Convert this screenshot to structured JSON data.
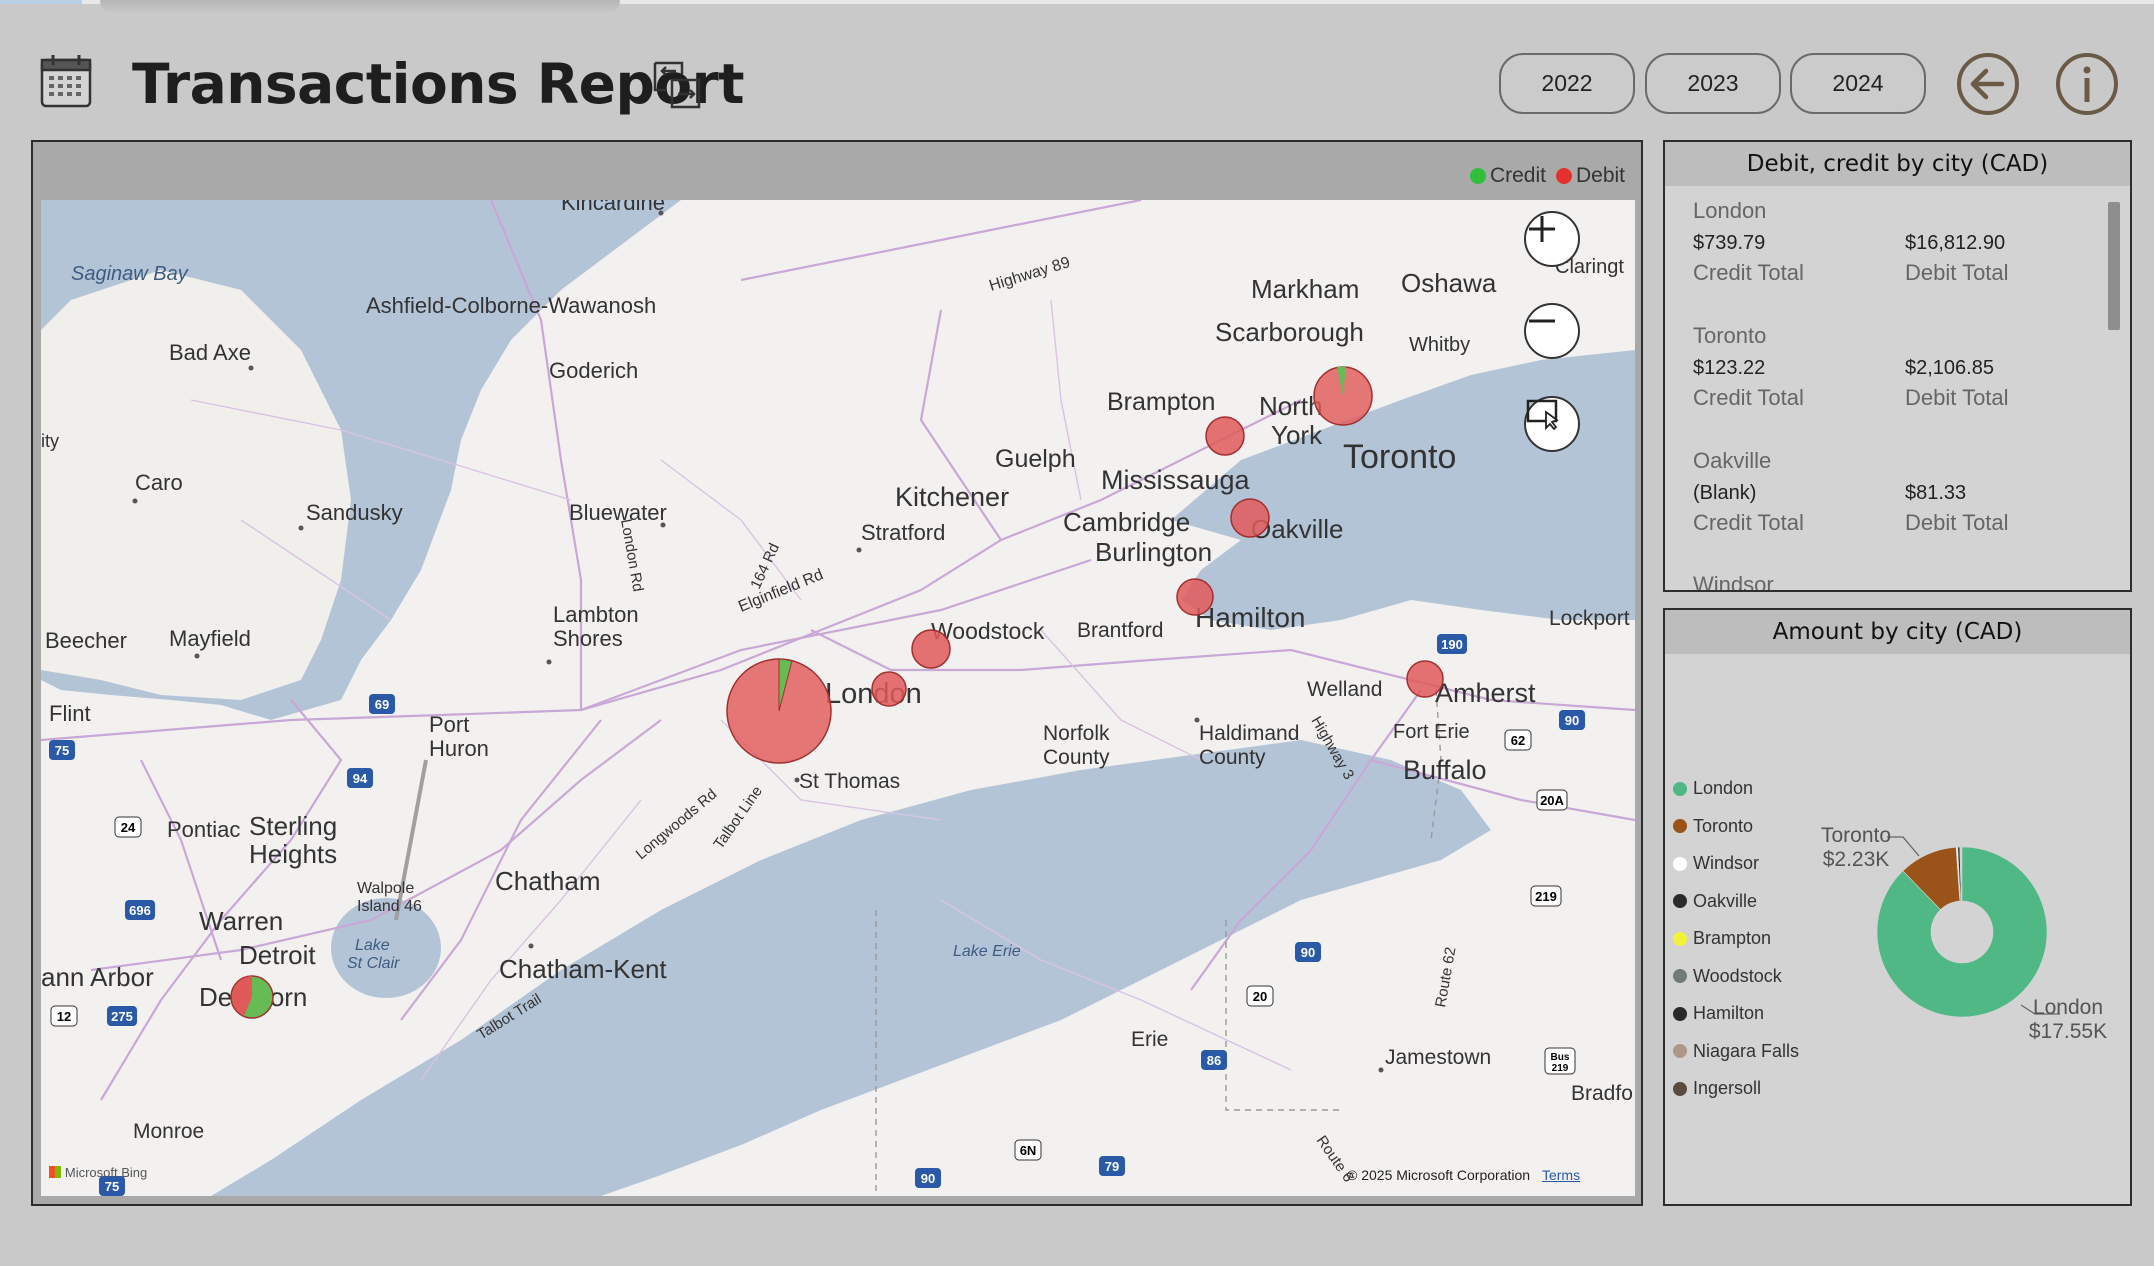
{
  "header": {
    "title": "Transactions Report",
    "years": [
      "2022",
      "2023",
      "2024"
    ]
  },
  "map_visual": {
    "legend": [
      {
        "label": "Credit",
        "color": "#2fbf3a"
      },
      {
        "label": "Debit",
        "color": "#e53030"
      }
    ],
    "places": [
      "Kincardine",
      "Saginaw Bay",
      "Ashfield-Colborne-Wawanosh",
      "Highway 89",
      "Claringt",
      "Markham",
      "Oshawa",
      "Whitby",
      "Bad Axe",
      "Goderich",
      "Scarborough",
      "Brampton",
      "North",
      "York",
      "Toronto",
      "Guelph",
      "Mississauga",
      "Kitchener",
      "Caro",
      "Sandusky",
      "Bluewater",
      "Stratford",
      "Cambridge",
      "Oakville",
      "Burlington",
      "London Rd",
      "164 Rd",
      "Lambton",
      "Shores",
      "Elginfield Rd",
      "Woodstock",
      "Brantford",
      "Hamilton",
      "Lockport",
      "Beecher",
      "Mayfield",
      "Welland",
      "Amherst",
      "Flint",
      "Port",
      "Huron",
      "London",
      "Fort Erie",
      "Norfolk",
      "County",
      "Haldimand",
      "County",
      "Buffalo",
      "St Thomas",
      "Pontiac",
      "Sterling",
      "Heights",
      "Longwoods Rd",
      "Talbot Line",
      "Chatham",
      "Walpole",
      "Island 46",
      "Warren",
      "Detroit",
      "Lake",
      "St Clair",
      "Lake Erie",
      "ann Arbor",
      "Chatham-Kent",
      "Dearborn",
      "Talbot Trail",
      "Erie",
      "Jamestown",
      "Monroe",
      "Bradfo",
      "Route 62",
      "Route 6",
      "ity",
      "Highway 3"
    ],
    "highway_shields": [
      "69",
      "75",
      "94",
      "24",
      "696",
      "275",
      "12",
      "190",
      "90",
      "62",
      "20A",
      "219",
      "90",
      "20",
      "86",
      "6N",
      "79",
      "90",
      "75",
      "Bus 219"
    ],
    "attribution": "© 2025 Microsoft Corporation",
    "terms": "Terms",
    "bing": "Microsoft Bing",
    "zoom_in_icon": "plus-icon",
    "zoom_out_icon": "minus-icon",
    "select_icon": "rect-select-icon"
  },
  "debit_credit_panel": {
    "title": "Debit, credit by city (CAD)",
    "cities": [
      {
        "name": "London",
        "credit": "$739.79",
        "debit": "$16,812.90",
        "credit_label": "Credit Total",
        "debit_label": "Debit Total"
      },
      {
        "name": "Toronto",
        "credit": "$123.22",
        "debit": "$2,106.85",
        "credit_label": "Credit Total",
        "debit_label": "Debit Total"
      },
      {
        "name": "Oakville",
        "credit": "(Blank)",
        "debit": "$81.33",
        "credit_label": "Credit Total",
        "debit_label": "Debit Total"
      },
      {
        "name": "Windsor"
      }
    ]
  },
  "amount_panel": {
    "title": "Amount by city (CAD)",
    "legend": [
      {
        "name": "London",
        "color": "#4fb884"
      },
      {
        "name": "Toronto",
        "color": "#9a5318"
      },
      {
        "name": "Windsor",
        "color": "#ffffff"
      },
      {
        "name": "Oakville",
        "color": "#2b2b2b"
      },
      {
        "name": "Brampton",
        "color": "#f2f23a"
      },
      {
        "name": "Woodstock",
        "color": "#6f7b7b"
      },
      {
        "name": "Hamilton",
        "color": "#2a2a2a"
      },
      {
        "name": "Niagara Falls",
        "color": "#b09888"
      },
      {
        "name": "Ingersoll",
        "color": "#5b4a3e"
      }
    ],
    "labels": {
      "toronto_name": "Toronto",
      "toronto_value": "$2.23K",
      "london_name": "London",
      "london_value": "$17.55K"
    }
  },
  "chart_data": {
    "type": "pie",
    "title": "Amount by city (CAD)",
    "categories": [
      "London",
      "Toronto",
      "Windsor",
      "Oakville",
      "Brampton",
      "Woodstock",
      "Hamilton",
      "Niagara Falls",
      "Ingersoll"
    ],
    "values": [
      17.55,
      2.23,
      0.06,
      0.08,
      0.02,
      0.02,
      0.02,
      0.01,
      0.01
    ],
    "unit": "K CAD"
  }
}
